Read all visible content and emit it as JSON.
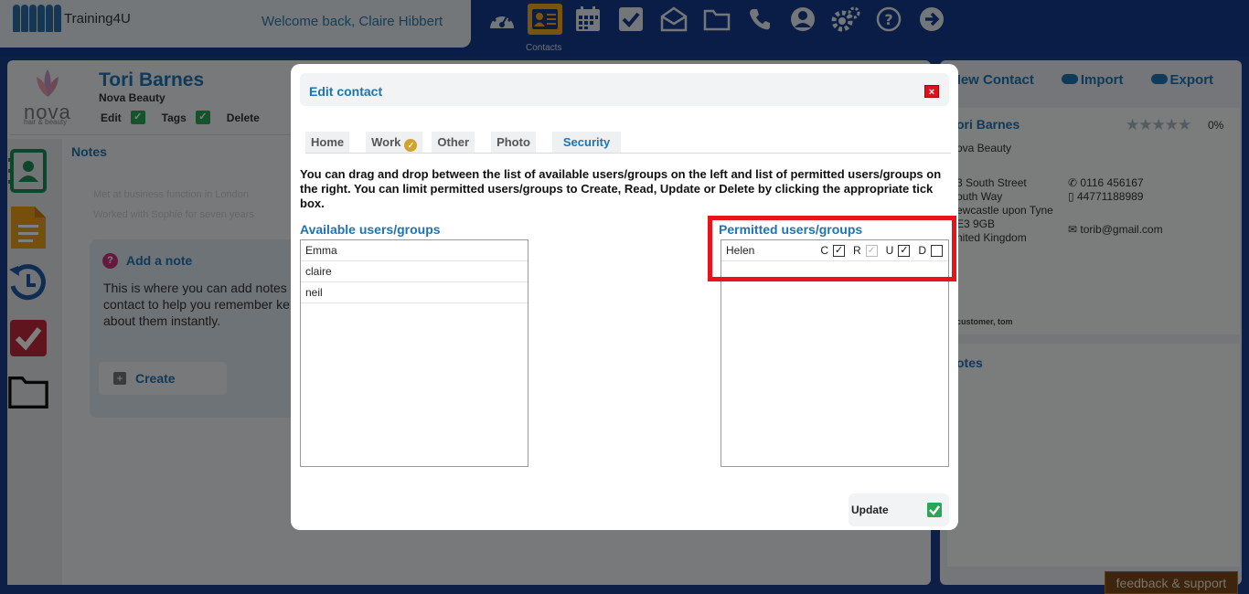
{
  "app": {
    "brand": "Training4U",
    "welcome": "Welcome back, Claire Hibbert",
    "active_nav_label": "Contacts",
    "nav_icons": [
      "dashboard-icon",
      "contacts-icon",
      "calendar-icon",
      "tasks-icon",
      "mail-icon",
      "folder-icon",
      "phone-icon",
      "user-icon",
      "settings-icon",
      "help-icon",
      "logout-icon"
    ]
  },
  "contact": {
    "name": "Tori Barnes",
    "company": "Nova Beauty",
    "logo_text": "nova",
    "logo_sub": "hair & beauty",
    "actions": [
      "Edit",
      "Tags",
      "Delete"
    ]
  },
  "notes": {
    "title": "Notes",
    "faded_lines": [
      "Met at business function in London",
      "Worked with Sophie for seven years"
    ],
    "add_title": "Add a note",
    "add_desc": "This is where you can add notes contact to help you remember ke about them instantly.",
    "create_label": "Create"
  },
  "right": {
    "new_contact": "New Contact",
    "import": "Import",
    "export": "Export",
    "name": "ori Barnes",
    "company": "ova Beauty",
    "rating_pct": "0%",
    "rating": 0,
    "address_lines": [
      "3 South Street",
      "outh Way",
      "ewcastle upon Tyne",
      "E3 9GB",
      "nited Kingdom"
    ],
    "phone": "0116 456167",
    "mobile": "44771188989",
    "email": "torib@gmail.com",
    "tags": "customer,   tom",
    "notes_title": "otes"
  },
  "feedback": "feedback & support",
  "modal": {
    "title": "Edit contact",
    "close": "×",
    "tabs": [
      "Home",
      "Work",
      "Other",
      "Photo",
      "Security"
    ],
    "active_tab": "Security",
    "instructions": "You can drag and drop between the list of available users/groups on the left and list of permitted users/groups on the right. You can limit permitted users/groups to Create, Read, Update or Delete by clicking the appropriate tick box.",
    "available_title": "Available users/groups",
    "available": [
      "Emma",
      "claire",
      "neil"
    ],
    "permitted_title": "Permitted users/groups",
    "permitted": [
      {
        "name": "Helen",
        "c": true,
        "r": true,
        "r_disabled": true,
        "u": true,
        "d": false
      }
    ],
    "perm_letters": {
      "c": "C",
      "r": "R",
      "u": "U",
      "d": "D"
    },
    "update_label": "Update"
  },
  "colors": {
    "accent": "#1e74b2",
    "highlight": "#e8141c",
    "nav_bg": "#123a8c"
  }
}
